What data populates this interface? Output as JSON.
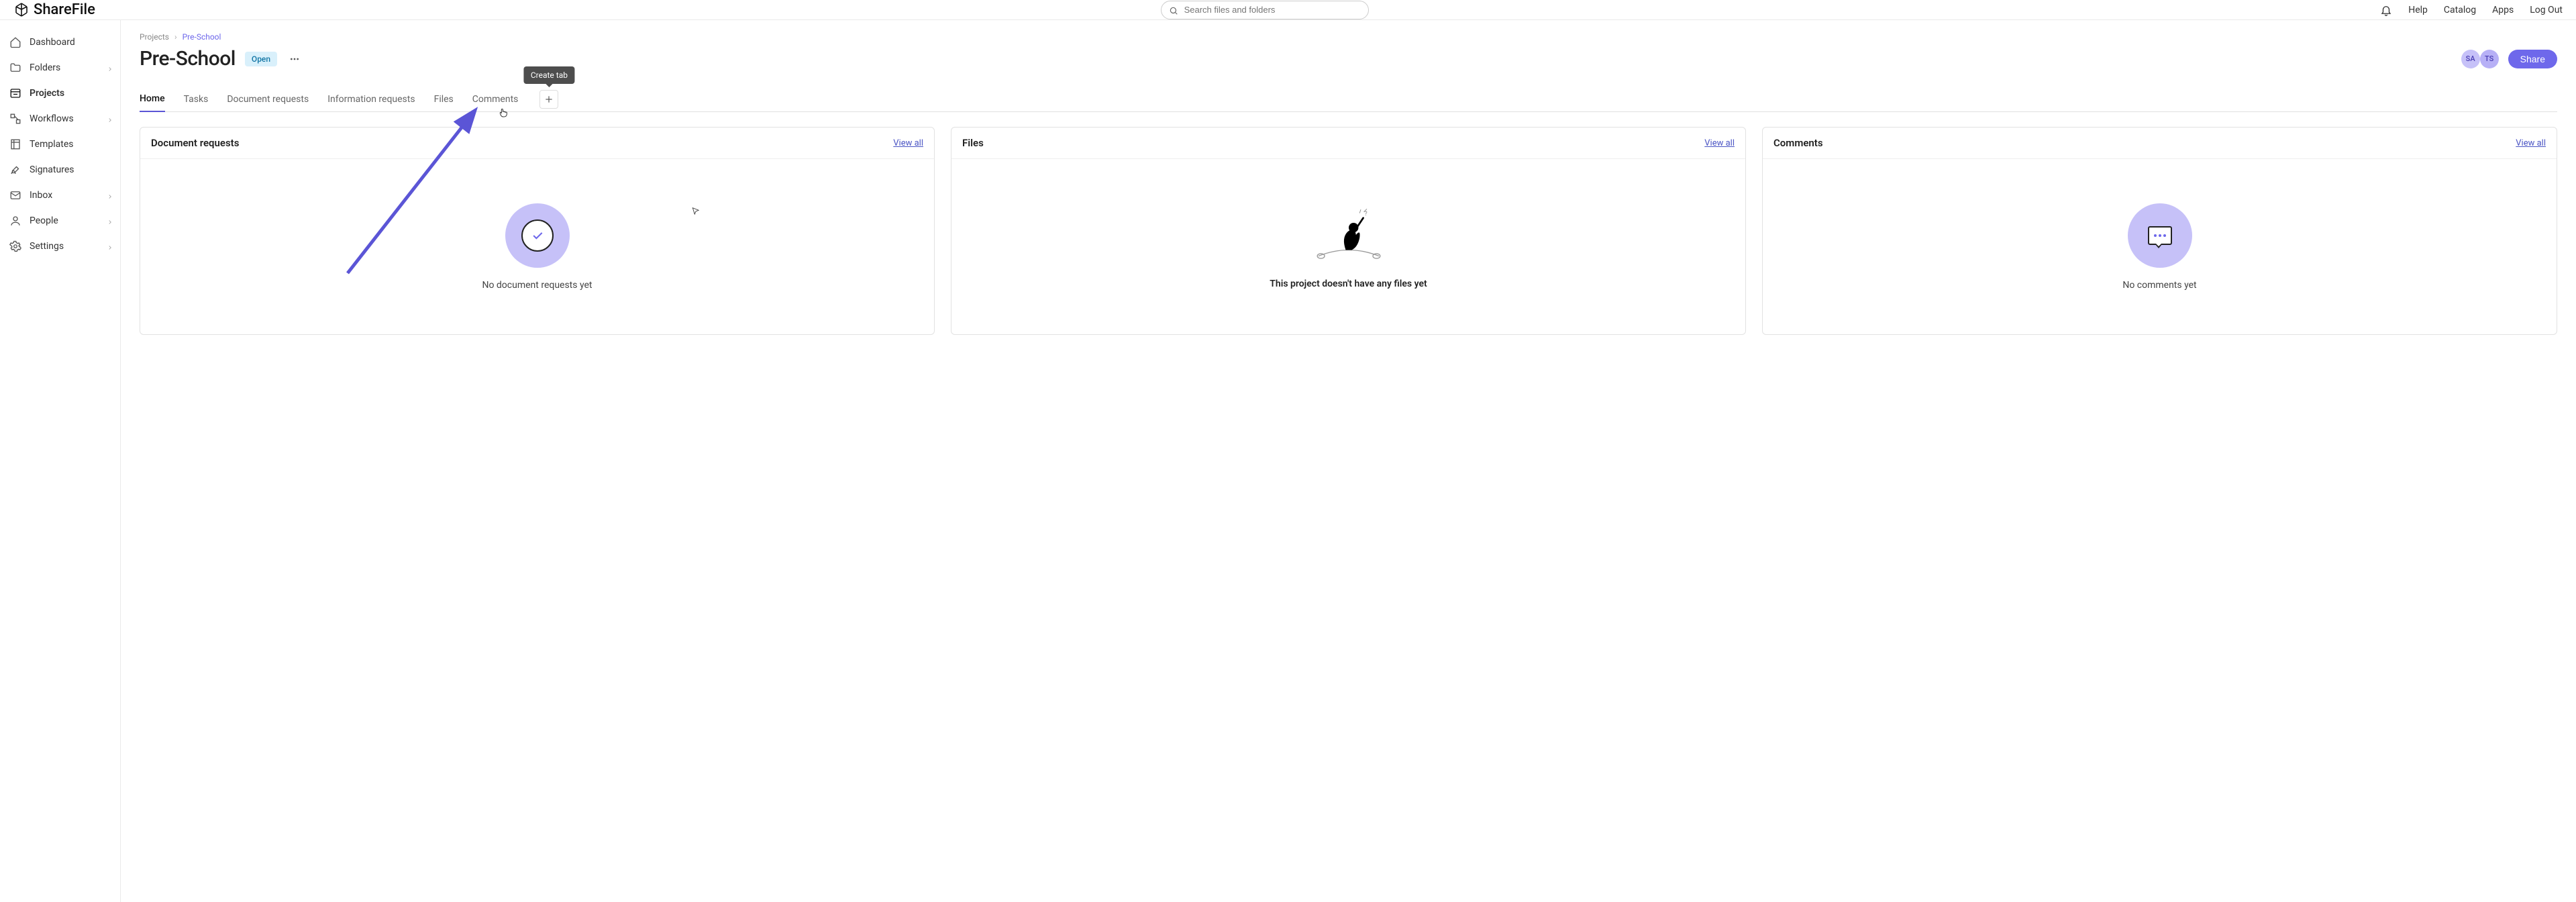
{
  "brand": "ShareFile",
  "search": {
    "placeholder": "Search files and folders"
  },
  "topnav": {
    "help": "Help",
    "catalog": "Catalog",
    "apps": "Apps",
    "logout": "Log Out"
  },
  "sidebar": {
    "dashboard": "Dashboard",
    "folders": "Folders",
    "projects": "Projects",
    "workflows": "Workflows",
    "templates": "Templates",
    "signatures": "Signatures",
    "inbox": "Inbox",
    "people": "People",
    "settings": "Settings"
  },
  "breadcrumb": {
    "root": "Projects",
    "current": "Pre-School"
  },
  "project": {
    "title": "Pre-School",
    "status": "Open",
    "avatars": [
      "SA",
      "TS"
    ],
    "share_label": "Share"
  },
  "tabs": {
    "home": "Home",
    "tasks": "Tasks",
    "docreq": "Document requests",
    "inforeq": "Information requests",
    "files": "Files",
    "comments": "Comments",
    "add_tooltip": "Create tab"
  },
  "cards": {
    "docreq": {
      "title": "Document requests",
      "viewall": "View all",
      "empty": "No document requests yet"
    },
    "files": {
      "title": "Files",
      "viewall": "View all",
      "empty": "This project doesn't have any files yet"
    },
    "comments": {
      "title": "Comments",
      "viewall": "View all",
      "empty": "No comments yet"
    }
  }
}
